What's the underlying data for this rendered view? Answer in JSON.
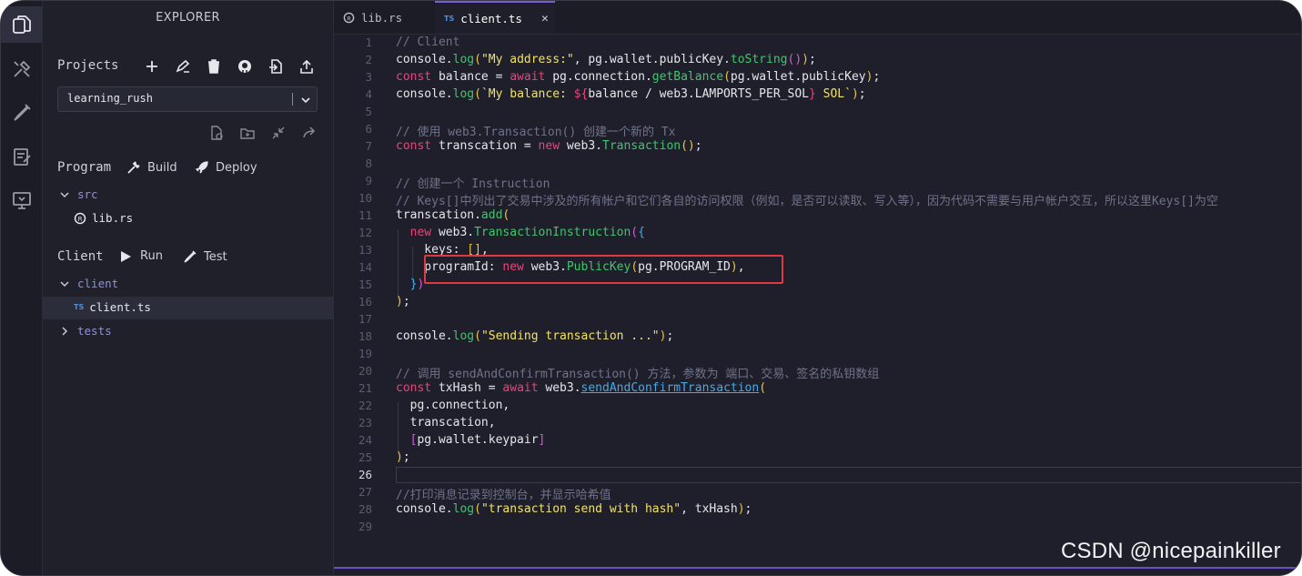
{
  "explorer": {
    "title": "EXPLORER",
    "projects_label": "Projects",
    "project_select": "learning_rush",
    "program_label": "Program",
    "build_label": "Build",
    "deploy_label": "Deploy",
    "client_label": "Client",
    "run_label": "Run",
    "test_label": "Test",
    "tree": {
      "src": "src",
      "lib": "lib.rs",
      "client_folder": "client",
      "client_file": "client.ts",
      "tests": "tests",
      "ts_badge": "TS"
    }
  },
  "tabs": [
    {
      "label": "lib.rs"
    },
    {
      "label": "client.ts",
      "badge": "TS"
    }
  ],
  "editor": {
    "line_numbers": [
      "1",
      "2",
      "3",
      "4",
      "5",
      "6",
      "7",
      "8",
      "9",
      "10",
      "11",
      "12",
      "13",
      "14",
      "15",
      "16",
      "17",
      "18",
      "19",
      "20",
      "21",
      "22",
      "23",
      "24",
      "25",
      "26",
      "27",
      "28",
      "29"
    ],
    "current_line": "26",
    "lines": [
      [
        [
          "c-comment",
          "// Client"
        ]
      ],
      [
        [
          "c-var",
          "console."
        ],
        [
          "c-fn",
          "log"
        ],
        [
          "c-brk",
          "("
        ],
        [
          "c-str",
          "\"My address:\""
        ],
        [
          "c-var",
          ", pg.wallet.publicKey."
        ],
        [
          "c-fn",
          "toString"
        ],
        [
          "c-brk2",
          "()"
        ],
        [
          "c-brk",
          ")"
        ],
        [
          "c-var",
          ";"
        ]
      ],
      [
        [
          "c-kw",
          "const"
        ],
        [
          "c-var",
          " balance = "
        ],
        [
          "c-kw",
          "await"
        ],
        [
          "c-var",
          " pg.connection."
        ],
        [
          "c-fn",
          "getBalance"
        ],
        [
          "c-brk",
          "("
        ],
        [
          "c-var",
          "pg.wallet.publicKey"
        ],
        [
          "c-brk",
          ")"
        ],
        [
          "c-var",
          ";"
        ]
      ],
      [
        [
          "c-var",
          "console."
        ],
        [
          "c-fn",
          "log"
        ],
        [
          "c-brk",
          "("
        ],
        [
          "c-tpl",
          "`My balance: "
        ],
        [
          "c-kw",
          "${"
        ],
        [
          "c-var",
          "balance / web3.LAMPORTS_PER_SOL"
        ],
        [
          "c-kw",
          "}"
        ],
        [
          "c-tpl",
          " SOL`"
        ],
        [
          "c-brk",
          ")"
        ],
        [
          "c-var",
          ";"
        ]
      ],
      [],
      [
        [
          "c-comment",
          "// 使用 web3.Transaction() 创建一个新的 Tx"
        ]
      ],
      [
        [
          "c-kw",
          "const"
        ],
        [
          "c-var",
          " transcation = "
        ],
        [
          "c-kw",
          "new"
        ],
        [
          "c-var",
          " web3."
        ],
        [
          "c-fn",
          "Transaction"
        ],
        [
          "c-brk",
          "()"
        ],
        [
          "c-var",
          ";"
        ]
      ],
      [],
      [
        [
          "c-comment",
          "// 创建一个 Instruction"
        ]
      ],
      [
        [
          "c-comment",
          "// Keys[]中列出了交易中涉及的所有帐户和它们各自的访问权限（例如，是否可以读取、写入等），因为代码不需要与用户帐户交互，所以这里Keys[]为空"
        ]
      ],
      [
        [
          "c-var",
          "transcation."
        ],
        [
          "c-fn",
          "add"
        ],
        [
          "c-brk",
          "("
        ]
      ],
      [
        [
          "c-var",
          "  "
        ],
        [
          "c-kw",
          "new"
        ],
        [
          "c-var",
          " web3."
        ],
        [
          "c-fn",
          "TransactionInstruction"
        ],
        [
          "c-brk2",
          "("
        ],
        [
          "c-brk3",
          "{"
        ]
      ],
      [
        [
          "c-var",
          "    keys: "
        ],
        [
          "c-brk",
          "[]"
        ],
        [
          "c-var",
          ","
        ]
      ],
      [
        [
          "c-var",
          "    programId: "
        ],
        [
          "c-kw",
          "new"
        ],
        [
          "c-var",
          " web3."
        ],
        [
          "c-fn",
          "PublicKey"
        ],
        [
          "c-brk",
          "("
        ],
        [
          "c-var",
          "pg.PROGRAM_ID"
        ],
        [
          "c-brk",
          ")"
        ],
        [
          "c-var",
          ","
        ]
      ],
      [
        [
          "c-var",
          "  "
        ],
        [
          "c-brk3",
          "}"
        ],
        [
          "c-brk2",
          ")"
        ]
      ],
      [
        [
          "c-brk",
          ")"
        ],
        [
          "c-var",
          ";"
        ]
      ],
      [],
      [
        [
          "c-var",
          "console."
        ],
        [
          "c-fn",
          "log"
        ],
        [
          "c-brk",
          "("
        ],
        [
          "c-str",
          "\"Sending transaction ...\""
        ],
        [
          "c-brk",
          ")"
        ],
        [
          "c-var",
          ";"
        ]
      ],
      [],
      [
        [
          "c-comment",
          "// 调用 sendAndConfirmTransaction() 方法，参数为 端口、交易、签名的私钥数组"
        ]
      ],
      [
        [
          "c-kw",
          "const"
        ],
        [
          "c-var",
          " txHash = "
        ],
        [
          "c-kw",
          "await"
        ],
        [
          "c-var",
          " web3."
        ],
        [
          "c-link",
          "sendAndConfirmTransaction"
        ],
        [
          "c-brk",
          "("
        ]
      ],
      [
        [
          "c-var",
          "  pg.connection,"
        ]
      ],
      [
        [
          "c-var",
          "  transcation,"
        ]
      ],
      [
        [
          "c-var",
          "  "
        ],
        [
          "c-brk2",
          "["
        ],
        [
          "c-var",
          "pg.wallet.keypair"
        ],
        [
          "c-brk2",
          "]"
        ]
      ],
      [
        [
          "c-brk",
          ")"
        ],
        [
          "c-var",
          ";"
        ]
      ],
      [],
      [
        [
          "c-comment",
          "//打印消息记录到控制台，并显示哈希值"
        ]
      ],
      [
        [
          "c-var",
          "console."
        ],
        [
          "c-fn",
          "log"
        ],
        [
          "c-brk",
          "("
        ],
        [
          "c-str",
          "\"transaction send with hash\""
        ],
        [
          "c-var",
          ", txHash"
        ],
        [
          "c-brk",
          ")"
        ],
        [
          "c-var",
          ";"
        ]
      ],
      []
    ]
  },
  "watermark": "CSDN @nicepainkiller",
  "colors": {
    "accent": "#7b5cd6",
    "highlight_box": "#e0383e"
  }
}
